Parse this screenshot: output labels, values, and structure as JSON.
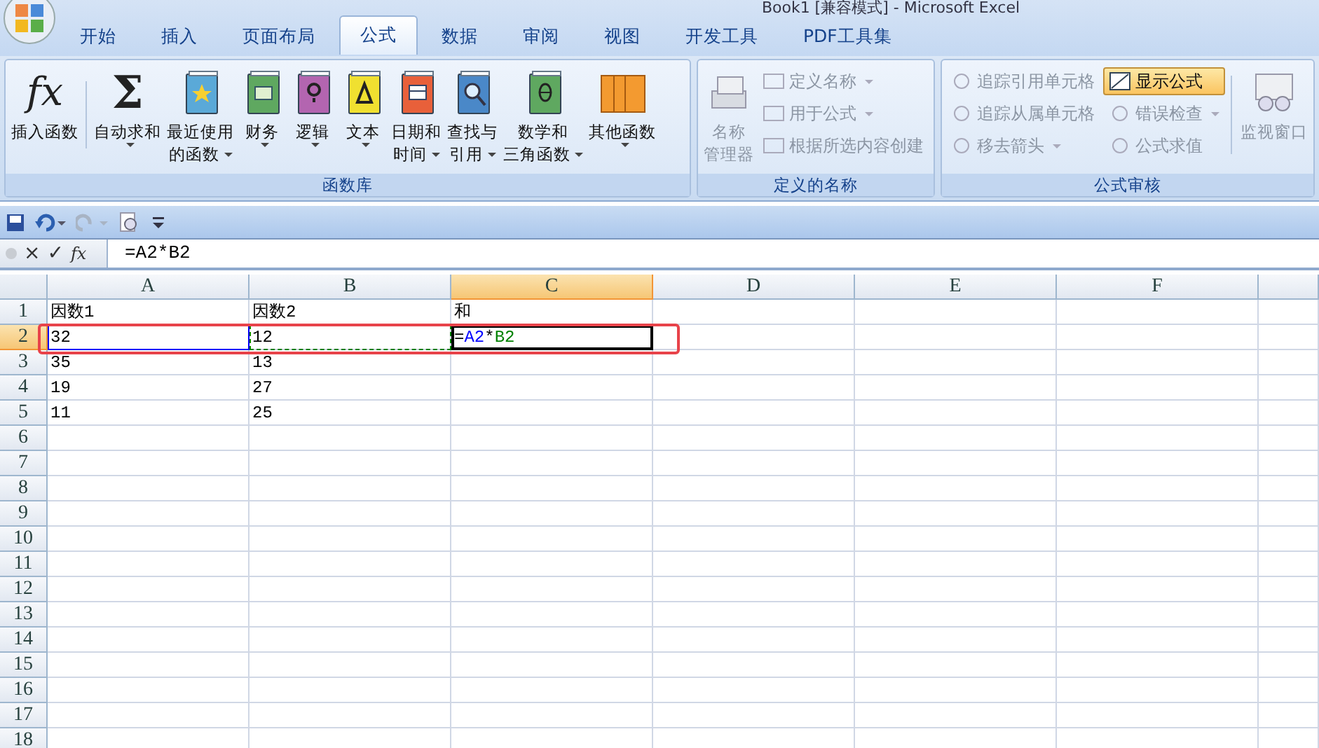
{
  "window": {
    "title": "Book1 [兼容模式] - Microsoft Excel"
  },
  "tabs": [
    {
      "label": "开始",
      "selected": false
    },
    {
      "label": "插入",
      "selected": false
    },
    {
      "label": "页面布局",
      "selected": false
    },
    {
      "label": "公式",
      "selected": true
    },
    {
      "label": "数据",
      "selected": false
    },
    {
      "label": "审阅",
      "selected": false
    },
    {
      "label": "视图",
      "selected": false
    },
    {
      "label": "开发工具",
      "selected": false
    },
    {
      "label": "PDF工具集",
      "selected": false
    }
  ],
  "ribbon": {
    "function_library": {
      "title": "函数库",
      "buttons": [
        {
          "kind": "glyph",
          "glyph": "fx",
          "lines": [
            "插入函数"
          ],
          "dropdown": false
        },
        {
          "kind": "glyph",
          "glyph": "Σ",
          "lines": [
            "自动求和"
          ],
          "dropdown": true
        },
        {
          "kind": "book",
          "color": "#5aa9d8",
          "lines": [
            "最近使用",
            "的函数"
          ],
          "dropdown": true
        },
        {
          "kind": "book",
          "color": "#5fa860",
          "lines": [
            "财务"
          ],
          "dropdown": true
        },
        {
          "kind": "book",
          "color": "#b365b0",
          "lines": [
            "逻辑"
          ],
          "dropdown": true
        },
        {
          "kind": "book",
          "color": "#f0e030",
          "lines": [
            "文本"
          ],
          "dropdown": true
        },
        {
          "kind": "book",
          "color": "#e8603a",
          "lines": [
            "日期和",
            "时间"
          ],
          "dropdown": true
        },
        {
          "kind": "book",
          "color": "#4a88c8",
          "lines": [
            "查找与",
            "引用"
          ],
          "dropdown": true
        },
        {
          "kind": "book",
          "color": "#5fa860",
          "lines": [
            "数学和",
            "三角函数"
          ],
          "dropdown": true
        },
        {
          "kind": "books",
          "color": "#f39a30",
          "lines": [
            "其他函数"
          ],
          "dropdown": true
        }
      ]
    },
    "defined_names": {
      "title": "定义的名称",
      "manager": {
        "lines": [
          "名称",
          "管理器"
        ],
        "disabled": true
      },
      "items": [
        {
          "label": "定义名称",
          "dropdown": true,
          "disabled": true
        },
        {
          "label": "用于公式",
          "dropdown": true,
          "disabled": true
        },
        {
          "label": "根据所选内容创建",
          "dropdown": false,
          "disabled": true
        }
      ]
    },
    "formula_auditing": {
      "title": "公式审核",
      "items": [
        {
          "label": "追踪引用单元格",
          "dropdown": false,
          "disabled": true,
          "selected": false
        },
        {
          "label": "显示公式",
          "dropdown": false,
          "disabled": false,
          "selected": true
        },
        {
          "label": "追踪从属单元格",
          "dropdown": false,
          "disabled": true,
          "selected": false
        },
        {
          "label": "错误检查",
          "dropdown": true,
          "disabled": true,
          "selected": false
        },
        {
          "label": "移去箭头",
          "dropdown": true,
          "disabled": true,
          "selected": false
        },
        {
          "label": "公式求值",
          "dropdown": false,
          "disabled": true,
          "selected": false
        }
      ],
      "watch": {
        "label": "监视窗口",
        "disabled": true
      }
    }
  },
  "formula_bar": {
    "cancel": "×",
    "enter": "✓",
    "function": "fx",
    "value": "=A2*B2"
  },
  "sheet": {
    "columns": [
      {
        "label": "A",
        "selected": false
      },
      {
        "label": "B",
        "selected": false
      },
      {
        "label": "C",
        "selected": true
      },
      {
        "label": "D",
        "selected": false
      },
      {
        "label": "E",
        "selected": false
      },
      {
        "label": "F",
        "selected": false
      }
    ],
    "rows": [
      {
        "header": "1",
        "selected": false,
        "cells": [
          {
            "text": "因数1"
          },
          {
            "text": "因数2"
          },
          {
            "text": "和"
          }
        ]
      },
      {
        "header": "2",
        "selected": true,
        "cells": [
          {
            "text": "32",
            "kind": "reference"
          },
          {
            "text": "12",
            "kind": "marquee"
          },
          {
            "parts": [
              {
                "text": "=",
                "color": "#000000"
              },
              {
                "text": "A2",
                "color": "#0000ff"
              },
              {
                "text": "*",
                "color": "#000000"
              },
              {
                "text": "B2",
                "color": "#008000"
              }
            ],
            "kind": "active"
          }
        ]
      },
      {
        "header": "3",
        "selected": false,
        "cells": [
          {
            "text": "35"
          },
          {
            "text": "13"
          }
        ]
      },
      {
        "header": "4",
        "selected": false,
        "cells": [
          {
            "text": "19"
          },
          {
            "text": "27"
          }
        ]
      },
      {
        "header": "5",
        "selected": false,
        "cells": [
          {
            "text": "11"
          },
          {
            "text": "25"
          }
        ]
      },
      {
        "header": "6",
        "selected": false
      },
      {
        "header": "7",
        "selected": false
      },
      {
        "header": "8",
        "selected": false
      },
      {
        "header": "9",
        "selected": false
      },
      {
        "header": "10",
        "selected": false
      },
      {
        "header": "11",
        "selected": false
      },
      {
        "header": "12",
        "selected": false
      },
      {
        "header": "13",
        "selected": false
      },
      {
        "header": "14",
        "selected": false
      },
      {
        "header": "15",
        "selected": false
      },
      {
        "header": "16",
        "selected": false
      },
      {
        "header": "17",
        "selected": false
      },
      {
        "header": "18",
        "selected": false
      }
    ]
  }
}
